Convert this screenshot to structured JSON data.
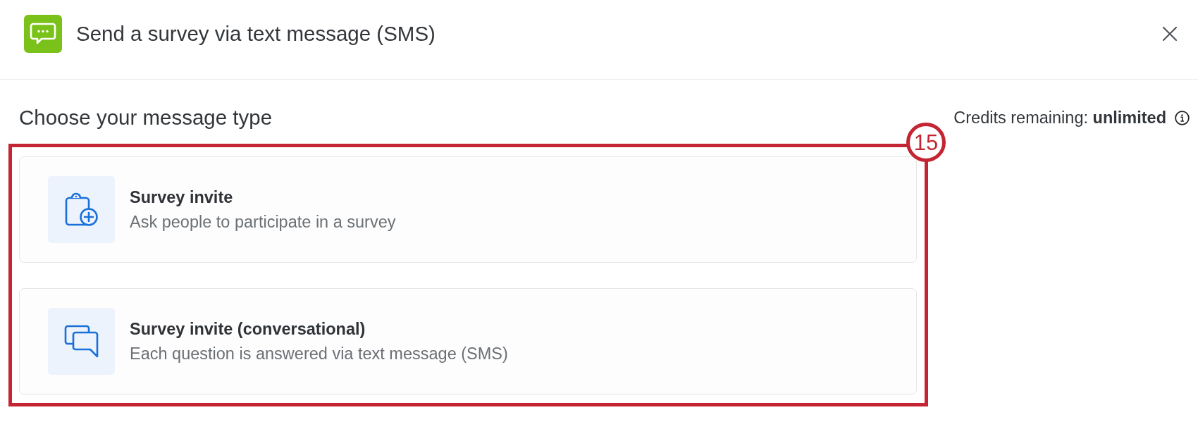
{
  "dialog": {
    "title": "Send a survey via text message (SMS)"
  },
  "section": {
    "heading": "Choose your message type",
    "credits": "Credits remaining: **unlimited**"
  },
  "message_types": [
    {
      "kind": "invite",
      "title": "Survey invite",
      "description": "Ask people to participate in a survey",
      "selected": false
    },
    {
      "kind": "conversational",
      "title": "Survey invite (conversational)",
      "description": "Each question is answered via text message (SMS)",
      "selected": false
    }
  ],
  "annotation": {
    "number": "15"
  }
}
